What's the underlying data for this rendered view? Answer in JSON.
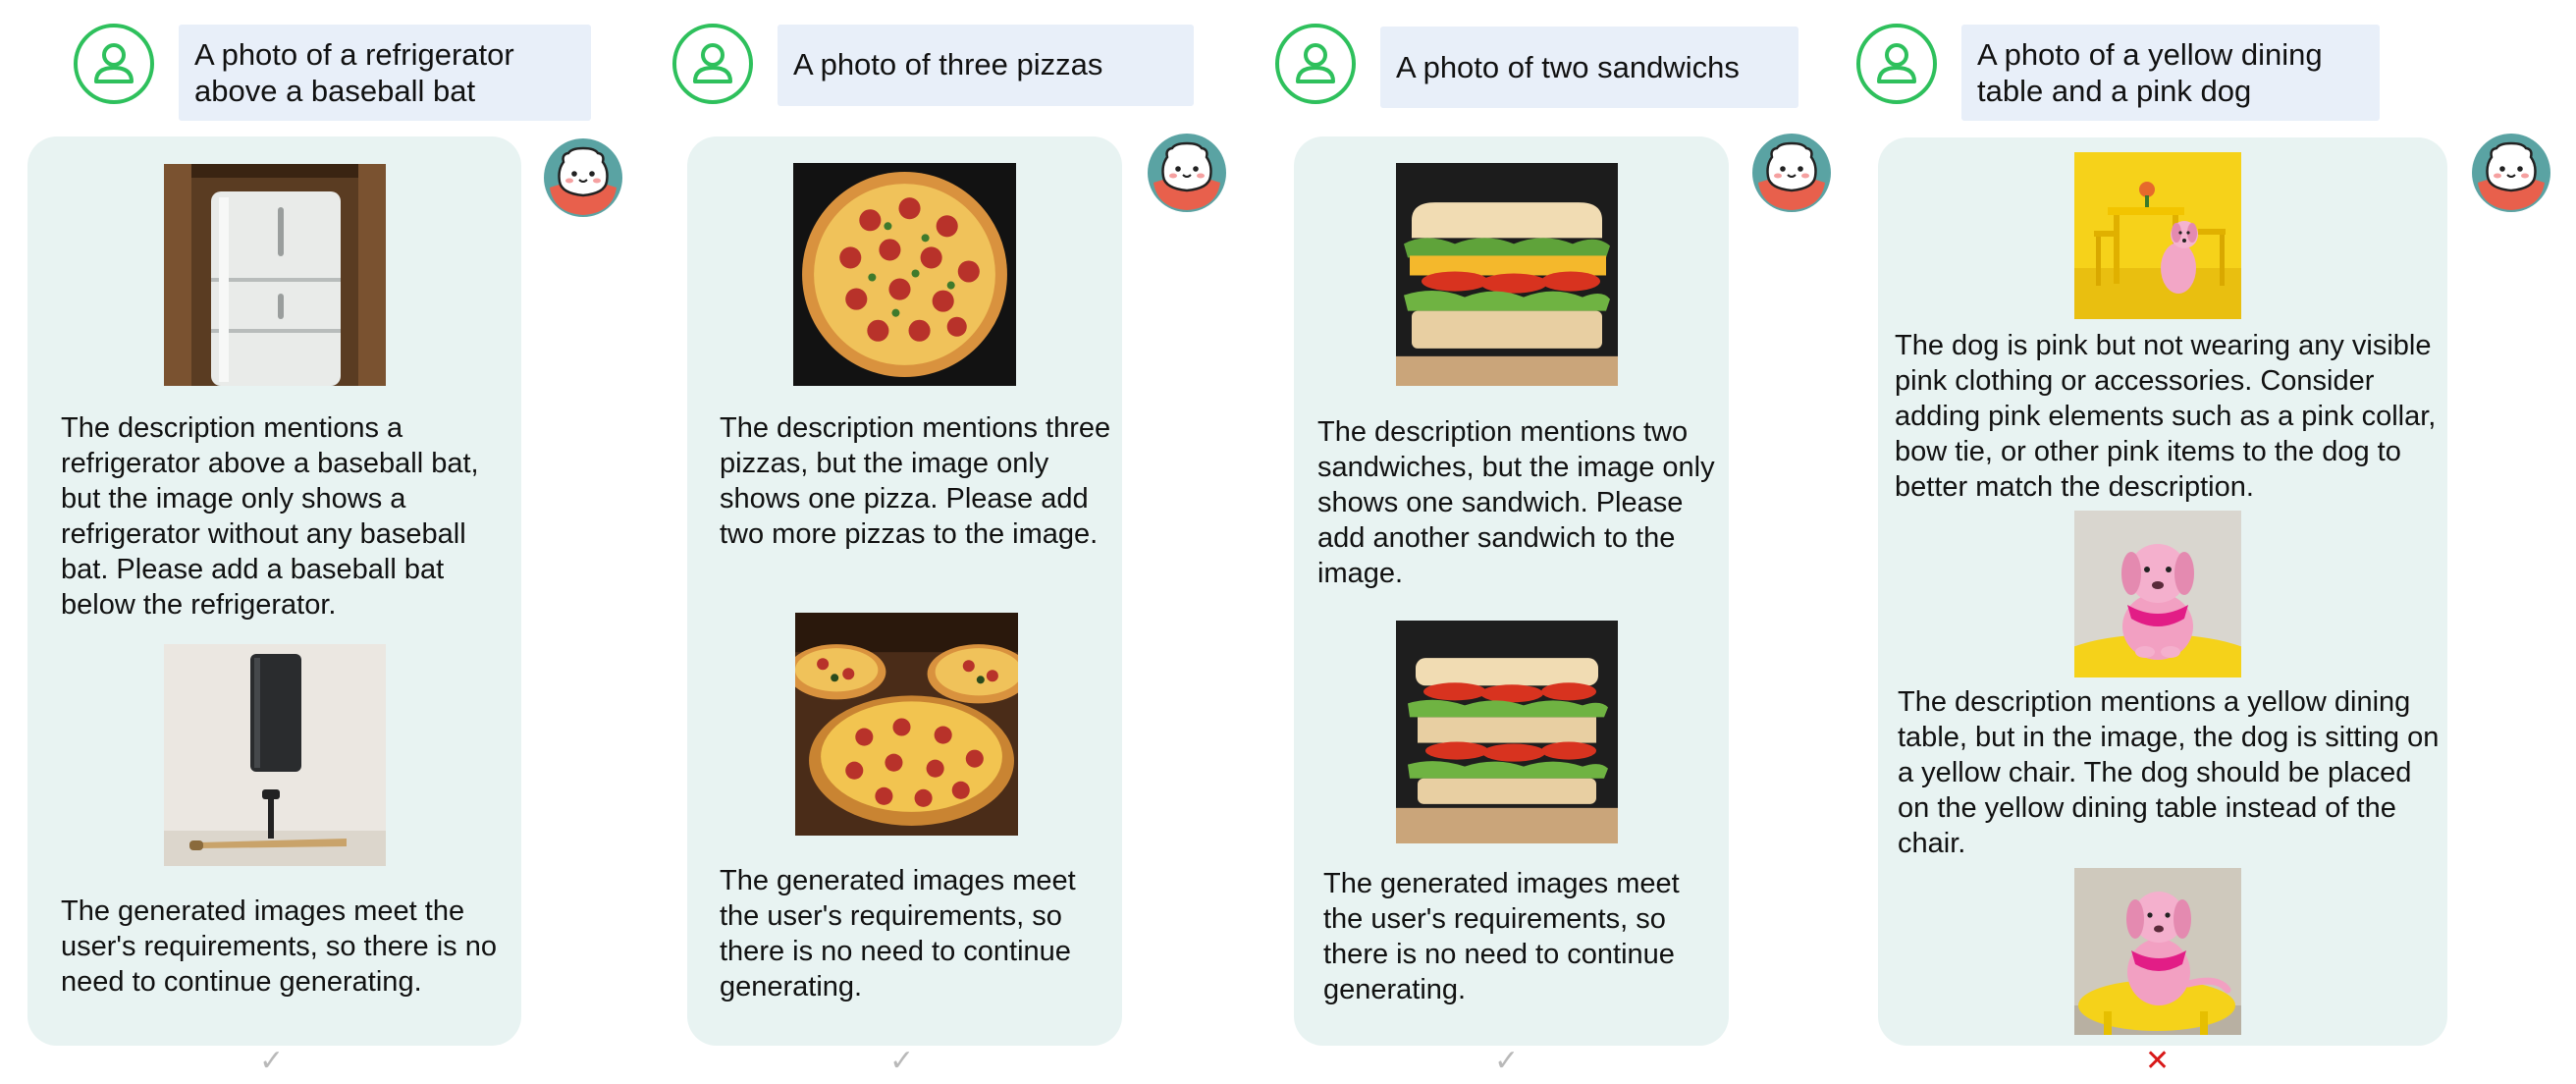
{
  "panels": [
    {
      "prompt": "A photo of a refrigerator above a baseball bat",
      "image_1": "refrigerator-photo",
      "feedback_1": "The description mentions a refrigerator above a baseball bat, but the image only shows a refrigerator without any baseball bat. Please add a baseball bat below the refrigerator.",
      "image_2": "wall-unit-and-baseball-bat-photo",
      "feedback_2": "The generated images meet the user's requirements, so there is no need to continue generating.",
      "result_symbol": "✓"
    },
    {
      "prompt": "A photo of three pizzas",
      "image_1": "single-pizza-photo",
      "feedback_1": "The description mentions three pizzas, but the image only shows one pizza. Please add two more pizzas to the image.",
      "image_2": "three-pizzas-photo",
      "feedback_2": "The generated images meet the user's requirements, so there is no need to continue generating.",
      "result_symbol": "✓"
    },
    {
      "prompt": "A photo of two sandwichs",
      "image_1": "single-sandwich-photo",
      "feedback_1": "The description mentions two sandwiches, but the image only shows one sandwich. Please add another sandwich to the image.",
      "image_2": "stacked-sandwiches-photo",
      "feedback_2": "The generated images meet the user's requirements, so there is no need to continue generating.",
      "result_symbol": "✓"
    },
    {
      "prompt": "A photo of a yellow dining table and a pink dog",
      "image_1": "pink-dog-yellow-room-photo",
      "feedback_1": "The dog is pink but not wearing any visible pink clothing or accessories. Consider adding pink elements such as a pink collar, bow tie, or other pink items to the dog to better match the description.",
      "image_2": "pink-dog-portrait-photo",
      "feedback_2": "The description mentions a yellow dining table, but in the image, the dog is sitting on a yellow chair. The dog should be placed on the yellow dining table instead of the chair.",
      "image_3": "pink-dog-on-yellow-chair-photo",
      "result_symbol": "✕"
    }
  ],
  "icons": {
    "user": "user-icon",
    "assistant": "robot-assistant-icon",
    "success": "check-icon",
    "failure": "cross-icon"
  },
  "colors": {
    "user_icon": "#2ec05c",
    "prompt_bg": "#e8eff9",
    "card_bg": "#e8f3f2",
    "success": "#b9b9b9",
    "failure": "#d81818"
  }
}
